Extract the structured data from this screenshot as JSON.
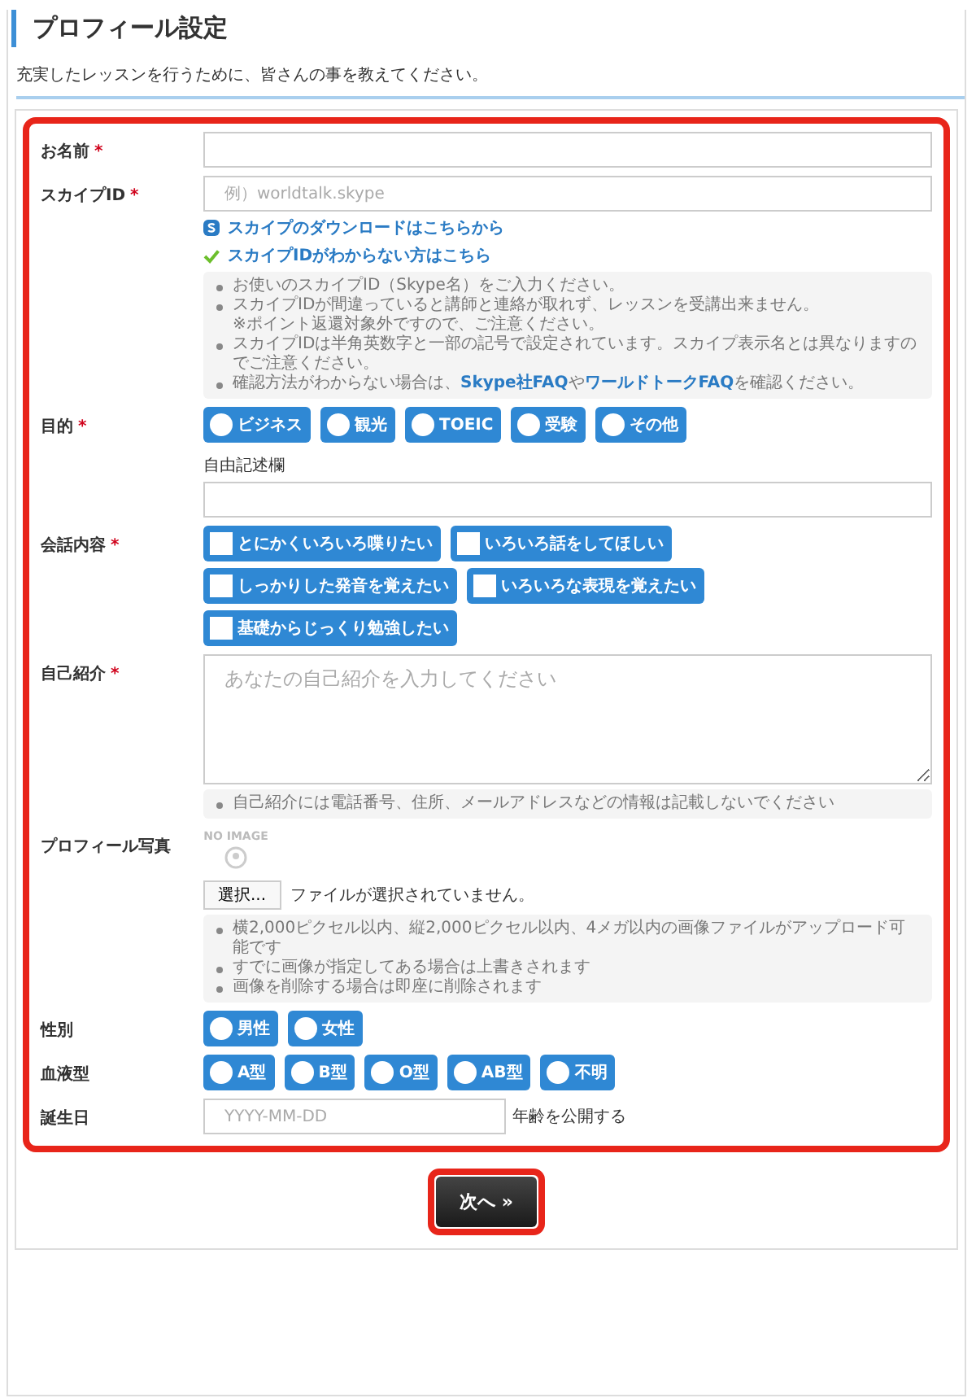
{
  "title": "プロフィール設定",
  "intro": "充実したレッスンを行うために、皆さんの事を教えてください。",
  "fields": [
    {
      "kind": "text",
      "label": "お名前",
      "required_mark": "*"
    },
    {
      "kind": "text",
      "label": "スカイプID",
      "required_mark": "*",
      "placeholder": "例）worldtalk.skype",
      "links": [
        {
          "kind": "download",
          "text": "スカイプのダウンロードはこちらから"
        },
        {
          "kind": "help",
          "text": "スカイプIDがわからない方はこちら"
        }
      ],
      "hints": [
        {
          "lines": [
            [
              {
                "text": "お使いのスカイプID（Skype名）をご入力ください。"
              }
            ]
          ]
        },
        {
          "lines": [
            [
              {
                "text": "スカイプIDが間違っていると講師と連絡が取れず、レッスンを受講出来ません。"
              }
            ],
            [
              {
                "text": "※ポイント返還対象外ですので、ご注意ください。"
              }
            ]
          ]
        },
        {
          "lines": [
            [
              {
                "text": "スカイプIDは半角英数字と一部の記号で設定されています。スカイプ表示名とは異なりますのでご注意ください。"
              }
            ]
          ]
        },
        {
          "lines": [
            [
              {
                "text": "確認方法がわからない場合は、"
              },
              {
                "link": "Skype社FAQ"
              },
              {
                "text": "や"
              },
              {
                "link": "ワールドトークFAQ"
              },
              {
                "text": "を確認ください。"
              }
            ]
          ]
        }
      ]
    },
    {
      "kind": "radio",
      "label": "目的",
      "required_mark": "*",
      "options": [
        {
          "label": "ビジネス",
          "selected": false
        },
        {
          "label": "観光",
          "selected": false
        },
        {
          "label": "TOEIC",
          "selected": false
        },
        {
          "label": "受験",
          "selected": false
        },
        {
          "label": "その他",
          "selected": false
        }
      ],
      "free_text": {
        "label": "自由記述欄"
      }
    },
    {
      "kind": "checkbox",
      "label": "会話内容",
      "required_mark": "*",
      "options": [
        {
          "label": "とにかくいろいろ喋りたい",
          "checked": false
        },
        {
          "label": "いろいろ話をしてほしい",
          "checked": false
        },
        {
          "label": "しっかりした発音を覚えたい",
          "checked": false
        },
        {
          "label": "いろいろな表現を覚えたい",
          "checked": false
        },
        {
          "label": "基礎からじっくり勉強したい",
          "checked": false
        }
      ]
    },
    {
      "kind": "textarea",
      "label": "自己紹介",
      "required_mark": "*",
      "placeholder": "あなたの自己紹介を入力してください",
      "hints": [
        {
          "lines": [
            [
              {
                "text": "自己紹介には電話番号、住所、メールアドレスなどの情報は記載しないでください"
              }
            ]
          ]
        }
      ]
    },
    {
      "kind": "photo",
      "label": "プロフィール写真",
      "no_image": "NO IMAGE",
      "file_button": "選択...",
      "file_status": "ファイルが選択されていません。",
      "hints": [
        {
          "lines": [
            [
              {
                "text": "横2,000ピクセル以内、縦2,000ピクセル以内、4メガ以内の画像ファイルがアップロード可能です"
              }
            ]
          ]
        },
        {
          "lines": [
            [
              {
                "text": "すでに画像が指定してある場合は上書きされます"
              }
            ]
          ]
        },
        {
          "lines": [
            [
              {
                "text": "画像を削除する場合は即座に削除されます"
              }
            ]
          ]
        }
      ]
    },
    {
      "kind": "radio",
      "label": "性別",
      "options": [
        {
          "label": "男性",
          "selected": false
        },
        {
          "label": "女性",
          "selected": false
        }
      ]
    },
    {
      "kind": "radio",
      "label": "血液型",
      "options": [
        {
          "label": "A型",
          "selected": false
        },
        {
          "label": "B型",
          "selected": false
        },
        {
          "label": "O型",
          "selected": false
        },
        {
          "label": "AB型",
          "selected": false
        },
        {
          "label": "不明",
          "selected": false
        }
      ]
    },
    {
      "kind": "date",
      "label": "誕生日",
      "placeholder": "YYYY-MM-DD",
      "side_text": "年齢を公開する"
    }
  ],
  "next_button": "次へ »"
}
